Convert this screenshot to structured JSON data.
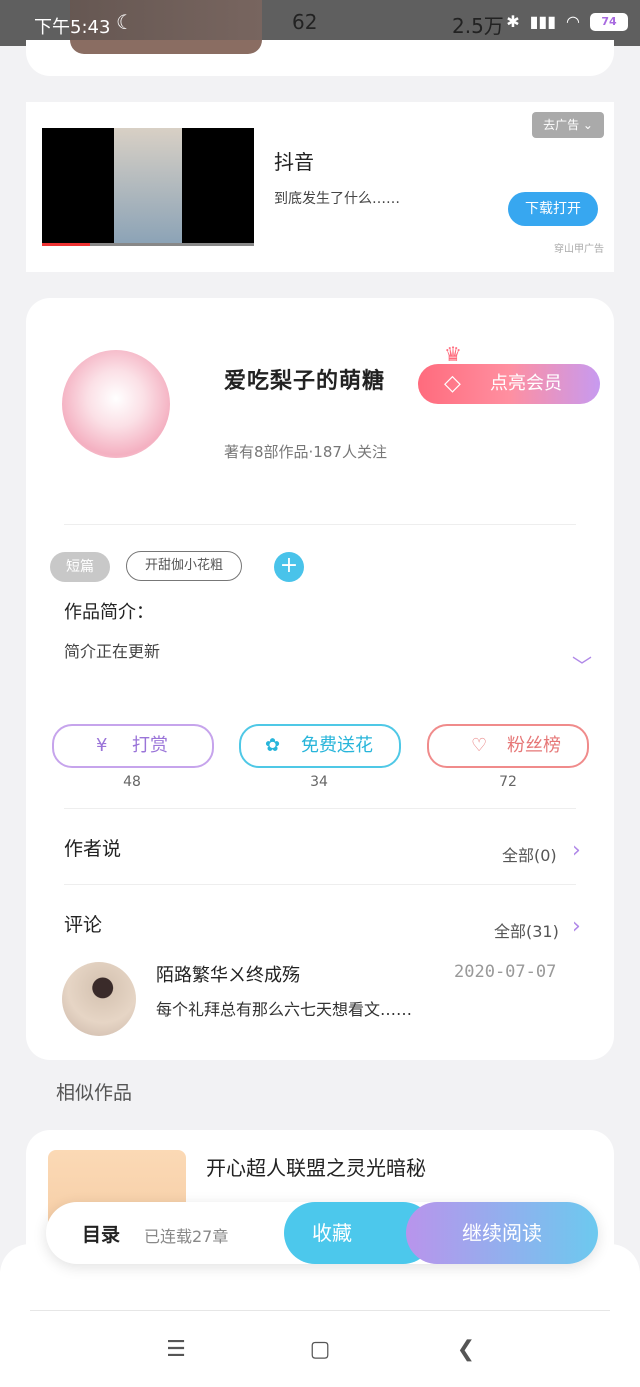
{
  "status_bar": {
    "time": "下午5:43",
    "moon_icon": "☾",
    "bg_num_left": "62",
    "bg_num_right": "2.5万",
    "battery": "74"
  },
  "ad": {
    "title": "抖音",
    "desc": "到底发生了什么……",
    "close_label": "去广告 ⌄",
    "cta_label": "下载打开",
    "source_tag": "穿山甲广告"
  },
  "author": {
    "name": "爱吃梨子的萌糖",
    "stats": "著有8部作品·187人关注",
    "vip_label": "点亮会员"
  },
  "tags": {
    "genre": "短篇",
    "tag1": "开甜伽小花粗",
    "add": "+"
  },
  "intro": {
    "heading": "作品简介：",
    "text": "简介正在更新"
  },
  "actions": {
    "reward_label": "打赏",
    "reward_count": "48",
    "flower_label": "免费送花",
    "flower_count": "34",
    "fans_label": "粉丝榜",
    "fans_count": "72"
  },
  "author_says": {
    "heading": "作者说",
    "all_label": "全部(0)"
  },
  "comments": {
    "heading": "评论",
    "all_label": "全部(31)",
    "items": [
      {
        "user": "陌路繁华ㄨ终成殇",
        "date": "2020-07-07",
        "text": "每个礼拜总有那么六七天想看文……"
      }
    ]
  },
  "similar": {
    "heading": "相似作品",
    "items": [
      {
        "title": "开心超人联盟之灵光暗秘"
      }
    ]
  },
  "bottom_bar": {
    "toc_label": "目录",
    "chapters_label": "已连载27章",
    "collect_label": "收藏",
    "read_label": "继续阅读"
  },
  "nav": {
    "menu_icon": "☰",
    "home_icon": "▢",
    "back_icon": "❮"
  }
}
